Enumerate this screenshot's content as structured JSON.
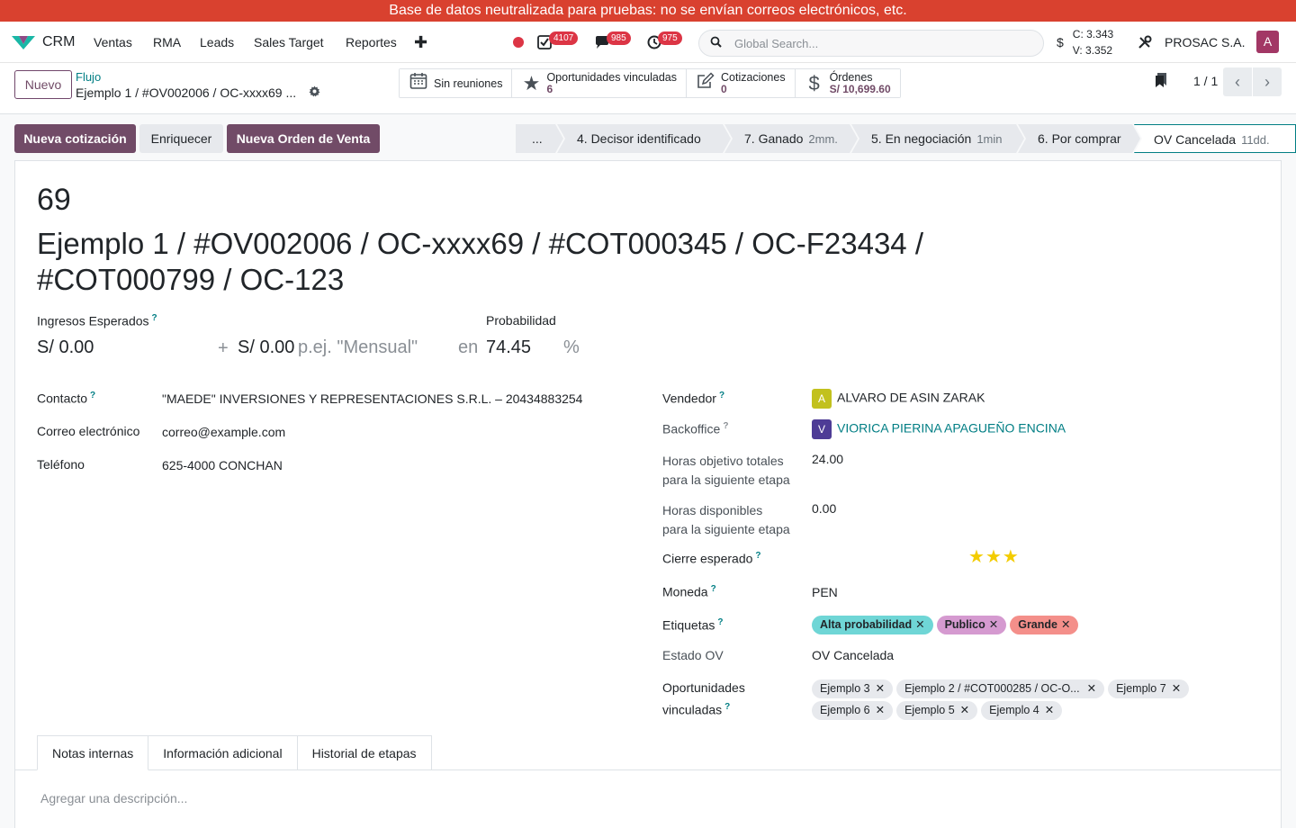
{
  "banner": "Base de datos neutralizada para pruebas: no se envían correos electrónicos, etc.",
  "nav": {
    "app_name": "CRM",
    "menu": [
      "Ventas",
      "RMA",
      "Leads",
      "Sales Target",
      "Reportes"
    ],
    "plus": "✚",
    "badges": {
      "activities": "4107",
      "messages": "985",
      "timer": "975"
    },
    "search_placeholder": "Global Search...",
    "currency_symbol": "$",
    "buy_rate": "C: 3.343",
    "sell_rate": "V: 3.352",
    "company": "PROSAC S.A.",
    "user_initial": "A"
  },
  "control": {
    "new_button": "Nuevo",
    "breadcrumb_parent": "Flujo",
    "breadcrumb_current": "Ejemplo 1 / #OV002006 / OC-xxxx69 ...",
    "smart_buttons": [
      {
        "label": "Sin reuniones",
        "value": ""
      },
      {
        "label": "Oportunidades vinculadas",
        "value": "6"
      },
      {
        "label": "Cotizaciones",
        "value": "0"
      },
      {
        "label": "Órdenes",
        "value": "S/ 10,699.60"
      }
    ],
    "pager": "1 / 1"
  },
  "actions": {
    "new_quote": "Nueva cotización",
    "enrich": "Enriquecer",
    "new_order": "Nueva Orden de Venta"
  },
  "stages": [
    {
      "label": "...",
      "duration": ""
    },
    {
      "label": "4. Decisor identificado",
      "duration": ""
    },
    {
      "label": "7. Ganado",
      "duration": "2mm."
    },
    {
      "label": "5. En negociación",
      "duration": "1min"
    },
    {
      "label": "6. Por comprar",
      "duration": ""
    },
    {
      "label": "OV Cancelada",
      "duration": "11dd."
    }
  ],
  "form": {
    "id": "69",
    "title": "Ejemplo 1 / #OV002006 / OC-xxxx69 / #COT000345 / OC-F23434 / #COT000799 / OC-123",
    "expected_revenue_label": "Ingresos Esperados",
    "expected_revenue": "S/ 0.00",
    "plus": "+",
    "recurring_revenue": "S/ 0.00",
    "recurring_placeholder": "p.ej. \"Mensual\"",
    "en": "en",
    "probability_label": "Probabilidad",
    "probability": "74.45",
    "percent": "%",
    "contact_label": "Contacto",
    "contact": "\"MAEDE\" INVERSIONES Y REPRESENTACIONES S.R.L. – 20434883254",
    "email_label": "Correo electrónico",
    "email": "correo@example.com",
    "phone_label": "Teléfono",
    "phone": "625-4000 CONCHAN",
    "salesperson_label": "Vendedor",
    "salesperson_initial": "A",
    "salesperson": "ALVARO DE ASIN ZARAK",
    "backoffice_label": "Backoffice",
    "backoffice_initial": "V",
    "backoffice": "VIORICA PIERINA APAGUEÑO ENCINA",
    "target_hours_label_1": "Horas objetivo totales",
    "target_hours_label_2": "para la siguiente etapa",
    "target_hours": "24.00",
    "available_hours_label_1": "Horas disponibles",
    "available_hours_label_2": "para la siguiente etapa",
    "available_hours": "0.00",
    "expected_close_label": "Cierre esperado",
    "priority_stars": 3,
    "currency_label": "Moneda",
    "currency": "PEN",
    "tags_label": "Etiquetas",
    "tags": [
      {
        "label": "Alta probabilidad",
        "color": "#6fd6d6"
      },
      {
        "label": "Publico",
        "color": "#d59ad0"
      },
      {
        "label": "Grande",
        "color": "#f48f8a"
      }
    ],
    "ov_state_label": "Estado OV",
    "ov_state": "OV Cancelada",
    "linked_label_1": "Oportunidades",
    "linked_label_2": "vinculadas",
    "linked": [
      "Ejemplo 3",
      "Ejemplo 2 / #COT000285 / OC-O...",
      "Ejemplo 7",
      "Ejemplo 6",
      "Ejemplo 5",
      "Ejemplo 4"
    ]
  },
  "tabs": [
    "Notas internas",
    "Información adicional",
    "Historial de etapas"
  ],
  "description_placeholder": "Agregar una descripción...",
  "colors": {
    "brand": "#714b67",
    "link": "#017e84",
    "banner": "#d9412f",
    "badge": "#dc3545",
    "salesperson_avatar": "#c2c11e",
    "backoffice_avatar": "#4e3c96",
    "user_avatar": "#a23765"
  }
}
